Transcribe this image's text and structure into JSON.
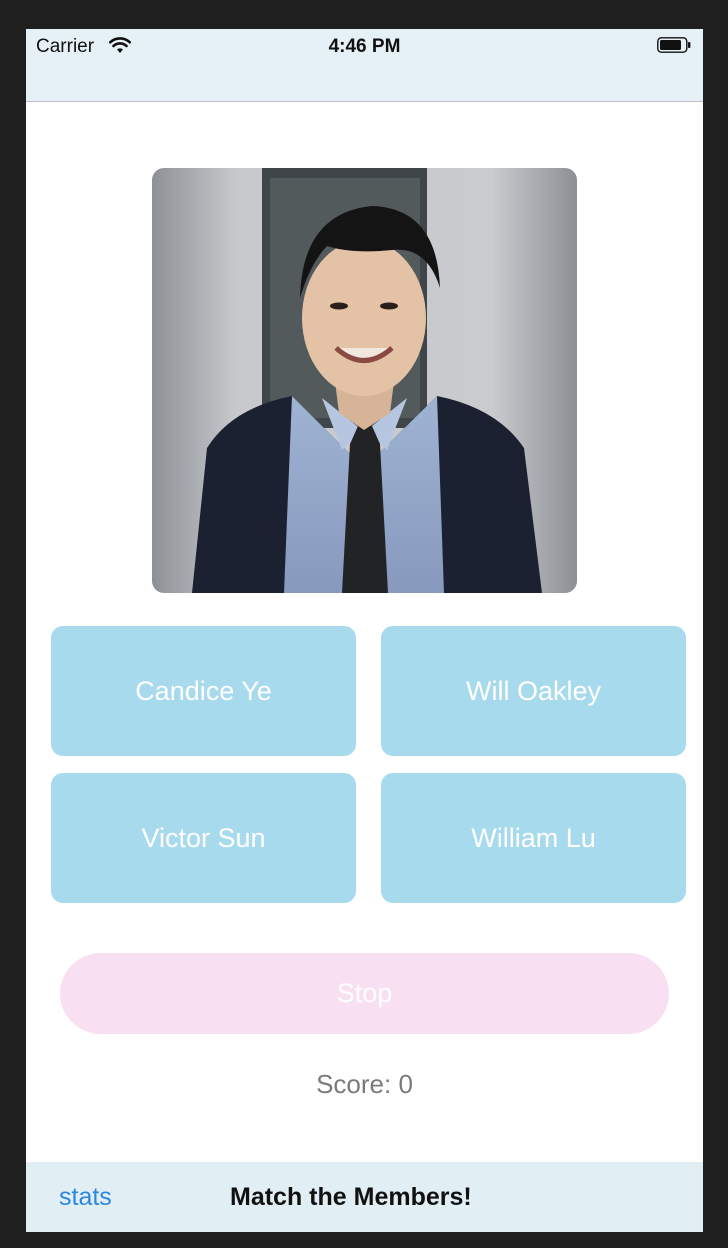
{
  "status_bar": {
    "carrier": "Carrier",
    "time": "4:46 PM",
    "icons": [
      "wifi-icon",
      "battery-icon"
    ]
  },
  "photo": {
    "subject": "member-portrait"
  },
  "answers": [
    {
      "label": "Candice Ye"
    },
    {
      "label": "Will Oakley"
    },
    {
      "label": "Victor Sun"
    },
    {
      "label": "William Lu"
    }
  ],
  "stop_button": {
    "label": "Stop"
  },
  "score": {
    "text": "Score: 0"
  },
  "bottom_bar": {
    "stats_label": "stats",
    "title": "Match the Members!"
  },
  "colors": {
    "answer_bg": "#a8daee",
    "stop_bg": "#f8e0f2",
    "link_blue": "#2d86e0",
    "bar_bg": "#e1eff4"
  }
}
